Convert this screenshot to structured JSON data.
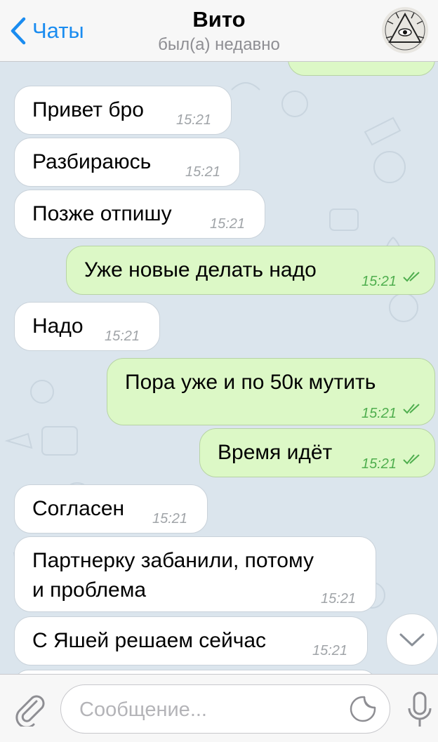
{
  "header": {
    "back_label": "Чаты",
    "title": "Вито",
    "status": "был(а) недавно"
  },
  "messages": [
    {
      "dir": "in",
      "text": "Привет бро",
      "time": "15:21"
    },
    {
      "dir": "in",
      "text": "Разбираюсь",
      "time": "15:21"
    },
    {
      "dir": "in",
      "text": "Позже отпишу",
      "time": "15:21"
    },
    {
      "dir": "out",
      "text": "Уже новые делать надо",
      "time": "15:21",
      "read": true
    },
    {
      "dir": "in",
      "text": "Надо",
      "time": "15:21"
    },
    {
      "dir": "out",
      "text": "Пора уже и по 50к мутить",
      "time": "15:21",
      "read": true
    },
    {
      "dir": "out",
      "text": "Время идёт",
      "time": "15:21",
      "read": true
    },
    {
      "dir": "in",
      "text": "Согласен",
      "time": "15:21"
    },
    {
      "dir": "in",
      "lines": [
        "Партнерку забанили, потому",
        "и проблема"
      ],
      "time": "15:21"
    },
    {
      "dir": "in",
      "text": "С Яшей решаем сейчас",
      "time": "15:21"
    }
  ],
  "input": {
    "placeholder": "Сообщение..."
  },
  "icons": {
    "back": "chevron-left-icon",
    "attach": "paperclip-icon",
    "sticker": "sticker-icon",
    "mic": "microphone-icon",
    "scroll": "chevron-down-icon"
  },
  "colors": {
    "accent": "#1a8cf0",
    "outgoing_bubble": "#dcf8c6",
    "incoming_bubble": "#ffffff",
    "read_ticks": "#4fae4e"
  }
}
